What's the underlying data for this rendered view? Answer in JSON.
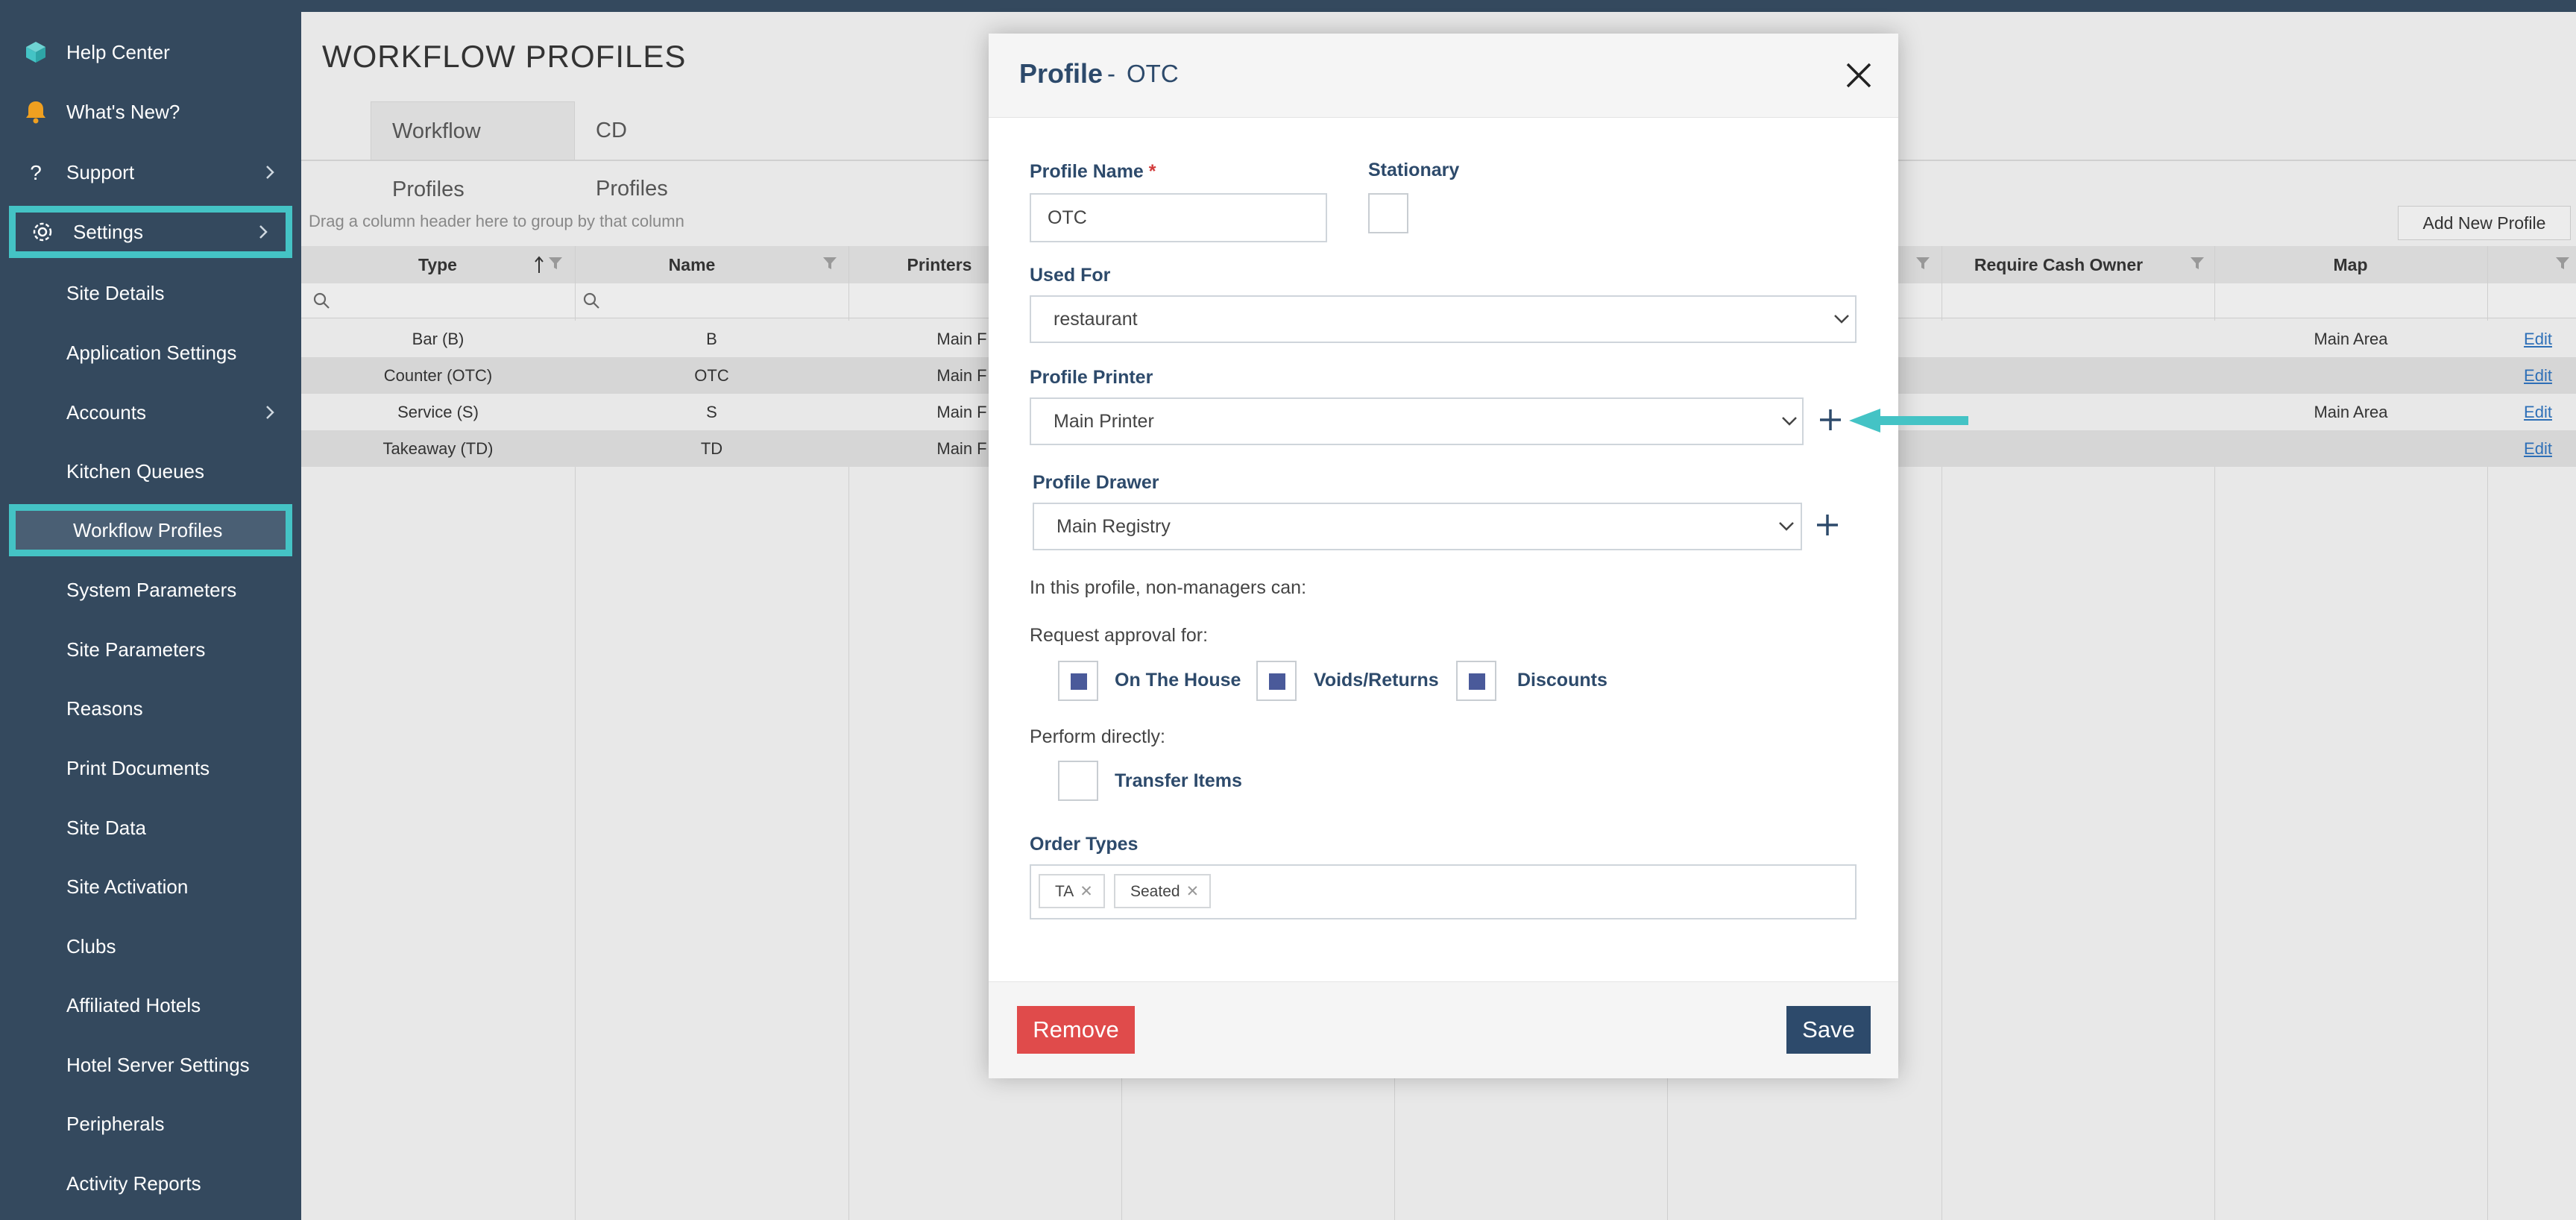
{
  "sidebar": {
    "items": [
      {
        "label": "Help Center",
        "icon": "cube-icon"
      },
      {
        "label": "What's New?",
        "icon": "bell-icon"
      },
      {
        "label": "Support",
        "icon": "question-icon"
      },
      {
        "label": "Settings",
        "icon": "gear-icon"
      },
      {
        "label": "Site Details"
      },
      {
        "label": "Application Settings"
      },
      {
        "label": "Accounts"
      },
      {
        "label": "Kitchen Queues"
      },
      {
        "label": "Workflow Profiles"
      },
      {
        "label": "System Parameters"
      },
      {
        "label": "Site Parameters"
      },
      {
        "label": "Reasons"
      },
      {
        "label": "Print Documents"
      },
      {
        "label": "Site Data"
      },
      {
        "label": "Site Activation"
      },
      {
        "label": "Clubs"
      },
      {
        "label": "Affiliated Hotels"
      },
      {
        "label": "Hotel Server Settings"
      },
      {
        "label": "Peripherals"
      },
      {
        "label": "Activity Reports"
      }
    ]
  },
  "main": {
    "title": "WORKFLOW PROFILES",
    "tabs": [
      "Workflow Profiles",
      "CD Profiles"
    ],
    "group_hint": "Drag a column header here to group by that column",
    "add_button": "Add New Profile",
    "columns": [
      "Type",
      "Name",
      "Printers",
      "Require Cash Owner",
      "Map"
    ],
    "rows": [
      {
        "type": "Bar (B)",
        "name": "B",
        "printer": "Main F",
        "map": "Main Area",
        "edit": "Edit"
      },
      {
        "type": "Counter (OTC)",
        "name": "OTC",
        "printer": "Main F",
        "map": "",
        "edit": "Edit"
      },
      {
        "type": "Service (S)",
        "name": "S",
        "printer": "Main F",
        "map": "Main Area",
        "edit": "Edit"
      },
      {
        "type": "Takeaway (TD)",
        "name": "TD",
        "printer": "Main F",
        "map": "",
        "edit": "Edit"
      }
    ]
  },
  "modal": {
    "title": "Profile",
    "separator": "-",
    "subtitle": "OTC",
    "profile_name_label": "Profile Name",
    "required_mark": "*",
    "profile_name_value": "OTC",
    "stationary_label": "Stationary",
    "used_for_label": "Used For",
    "used_for_value": "restaurant",
    "profile_printer_label": "Profile Printer",
    "profile_printer_value": "Main Printer",
    "profile_drawer_label": "Profile Drawer",
    "profile_drawer_value": "Main Registry",
    "nonmanagers_text": "In this profile, non-managers can:",
    "request_approval_label": "Request approval for:",
    "approvals": [
      {
        "label": "On The House",
        "checked": true
      },
      {
        "label": "Voids/Returns",
        "checked": true
      },
      {
        "label": "Discounts",
        "checked": true
      }
    ],
    "perform_directly_label": "Perform directly:",
    "transfer_items_label": "Transfer Items",
    "order_types_label": "Order Types",
    "order_types": [
      "TA",
      "Seated"
    ],
    "remove_button": "Remove",
    "save_button": "Save"
  },
  "colors": {
    "sidebar_bg": "#34495e",
    "highlight": "#44c3c5",
    "primary": "#2d4a6b",
    "danger": "#e04b4b",
    "checkbox_fill": "#4a5a9a"
  }
}
